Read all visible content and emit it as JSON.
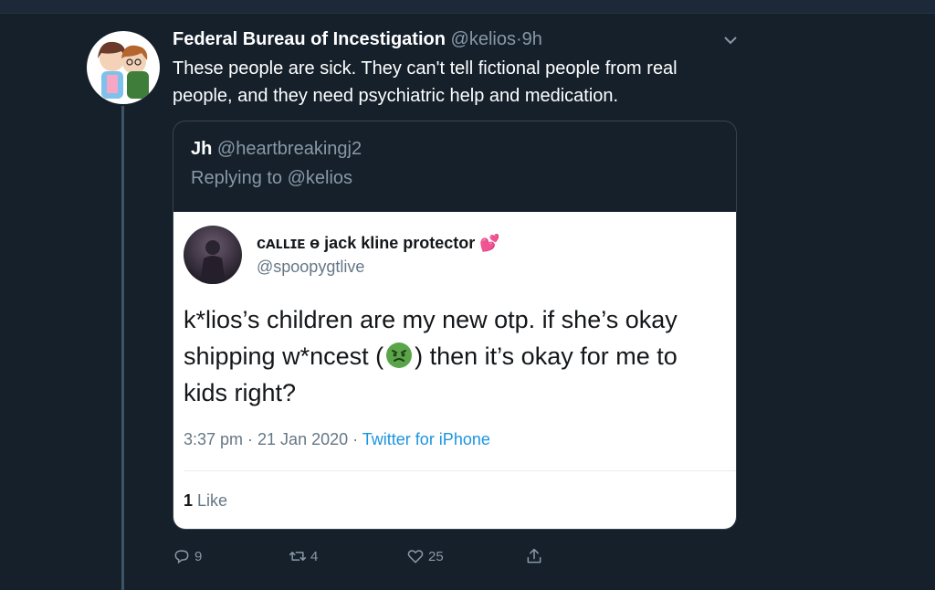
{
  "tweet": {
    "display_name": "Federal Bureau of Incestigation",
    "handle": "@kelios",
    "separator": "·",
    "time": "9h",
    "text": "These people are sick. They can't tell fictional people from real people, and they need psychiatric help and medication."
  },
  "quote": {
    "display_name": "Jh",
    "handle": "@heartbreakingj2",
    "replying_to": "Replying to @kelios",
    "screenshot": {
      "display_name": "cᴀʟʟɪᴇ ɵ jack kline protector",
      "heart_emoji": "💕",
      "handle": "@spoopygtlive",
      "lines": [
        "k*lios’s children are my new otp. if she’s okay",
        "shipping w*ncest (",
        ") then it’s okay for me to",
        "kids right?"
      ],
      "timestamp": "3:37 pm · 21 Jan 2020",
      "meta_separator": " · ",
      "source": "Twitter for iPhone",
      "likes_count": "1",
      "likes_label": "Like"
    }
  },
  "actions": {
    "replies": "9",
    "retweets": "4",
    "likes": "25"
  },
  "colors": {
    "background": "#15202b",
    "secondary_text": "#8899a6",
    "link": "#1b95e0"
  },
  "icons": [
    "chevron-down-icon",
    "reply-icon",
    "retweet-icon",
    "like-icon",
    "share-icon",
    "nauseated-face-emoji"
  ]
}
